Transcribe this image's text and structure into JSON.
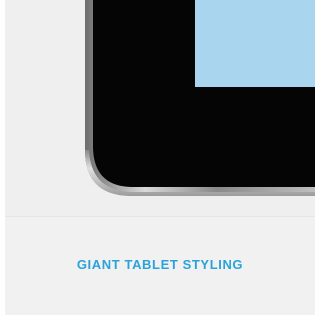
{
  "card": {
    "caption": "GIANT TABLET STYLING"
  },
  "colors": {
    "caption": "#2aa3d9",
    "card_background": "#f1f1f1",
    "tablet_bezel": "#050505",
    "tablet_screen": "#a9d6ee",
    "tablet_frame": "#9a9a9a"
  },
  "image": {
    "subject": "tablet-corner"
  }
}
